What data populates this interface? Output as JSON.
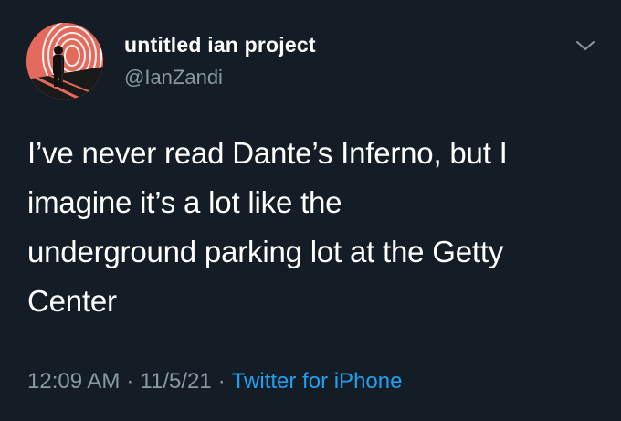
{
  "user": {
    "display_name": "untitled ian project",
    "handle": "@IanZandi"
  },
  "tweet": {
    "text_lines": [
      "I’ve never read Dante’s Inferno, but I",
      "imagine it’s a lot like the",
      "underground parking lot at the Getty",
      "Center"
    ],
    "time": "12:09 AM",
    "date": "11/5/21",
    "separator": "·",
    "source": "Twitter for iPhone"
  },
  "icons": {
    "menu": "chevron-down-icon"
  },
  "colors": {
    "background": "#141d26",
    "secondary_text": "#8899a6",
    "link": "#1da1f2",
    "avatar_accent": "#e56a5e"
  }
}
